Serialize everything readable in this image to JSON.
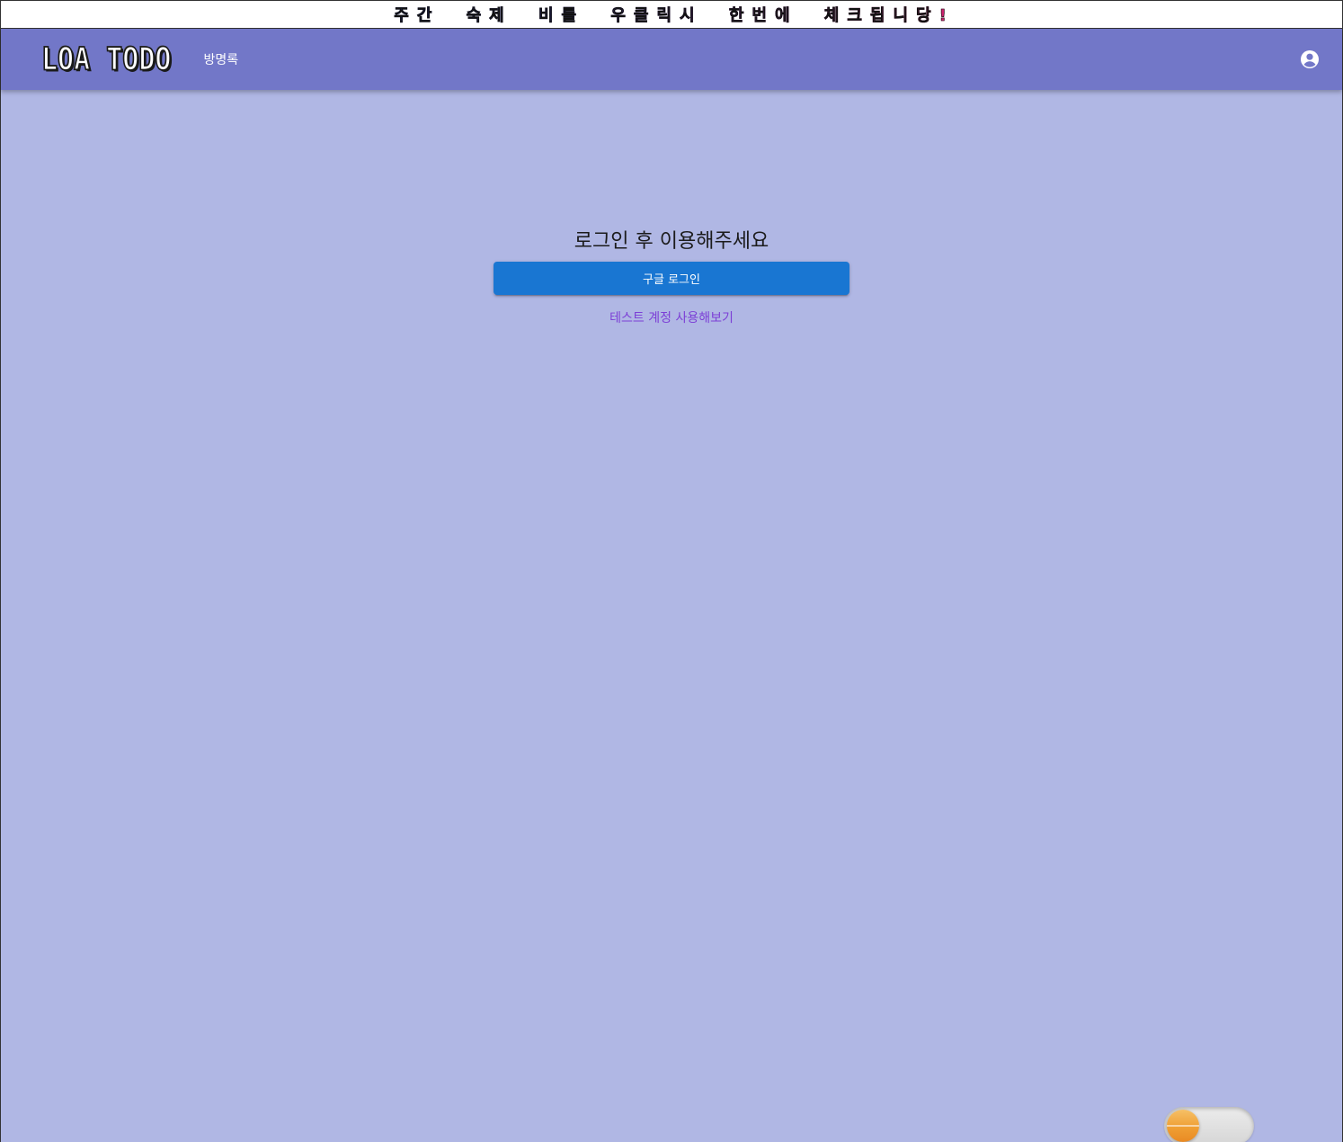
{
  "banner": {
    "text": "주간 숙제 비를 우클릭시 한번에 체크됩니당!"
  },
  "appbar": {
    "logo": "LOA TODO",
    "nav": {
      "guestbook_label": "방명록"
    },
    "account_icon": "account-circle-icon"
  },
  "main": {
    "headline": "로그인 후 이용해주세요",
    "google_login_label": "구글 로그인",
    "test_account_label": "테스트 계정 사용해보기"
  },
  "theme_toggle": {
    "icon": "sun-icon",
    "state": "light"
  },
  "colors": {
    "background": "#b0b7e4",
    "appbar": "#7277c8",
    "primary_button": "#1976d2",
    "link": "#7c3fd6"
  }
}
